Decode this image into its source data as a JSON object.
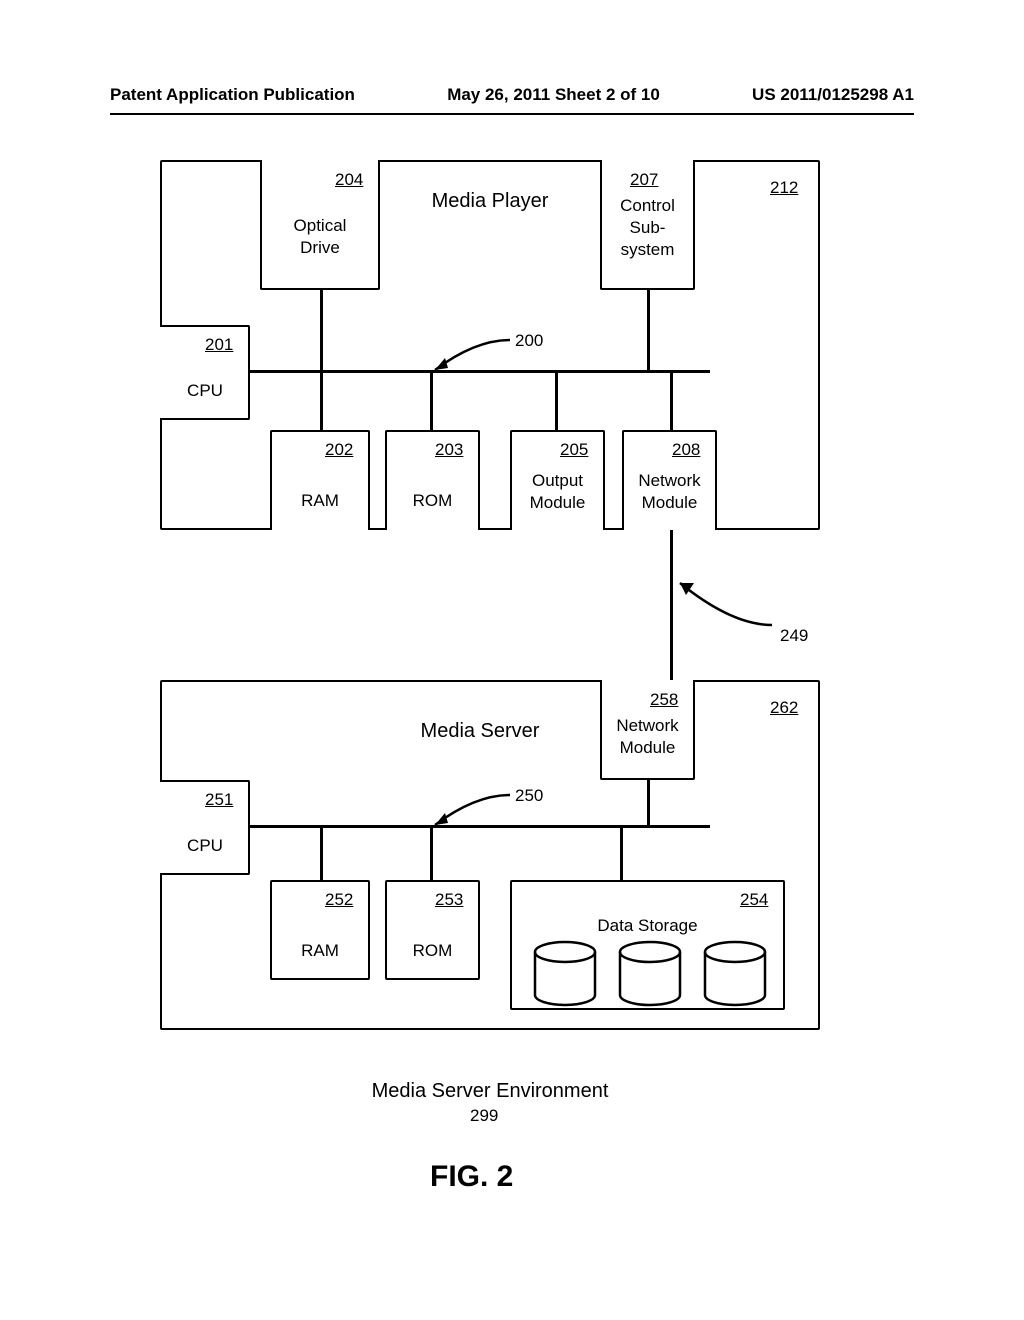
{
  "header": {
    "left": "Patent Application Publication",
    "center": "May 26, 2011  Sheet 2 of 10",
    "right": "US 2011/0125298 A1"
  },
  "player": {
    "title": "Media Player",
    "ref": "212",
    "bus_ref": "200",
    "cpu": {
      "ref": "201",
      "label": "CPU"
    },
    "optical": {
      "ref": "204",
      "label": "Optical\nDrive"
    },
    "control": {
      "ref": "207",
      "label": "Control\nSub-\nsystem"
    },
    "ram": {
      "ref": "202",
      "label": "RAM"
    },
    "rom": {
      "ref": "203",
      "label": "ROM"
    },
    "output": {
      "ref": "205",
      "label": "Output\nModule"
    },
    "net": {
      "ref": "208",
      "label": "Network\nModule"
    }
  },
  "link_ref": "249",
  "server": {
    "title": "Media Server",
    "ref": "262",
    "bus_ref": "250",
    "cpu": {
      "ref": "251",
      "label": "CPU"
    },
    "net": {
      "ref": "258",
      "label": "Network\nModule"
    },
    "ram": {
      "ref": "252",
      "label": "RAM"
    },
    "rom": {
      "ref": "253",
      "label": "ROM"
    },
    "storage": {
      "ref": "254",
      "label": "Data Storage"
    }
  },
  "environment": {
    "label": "Media Server Environment",
    "ref": "299"
  },
  "figure": "FIG. 2"
}
